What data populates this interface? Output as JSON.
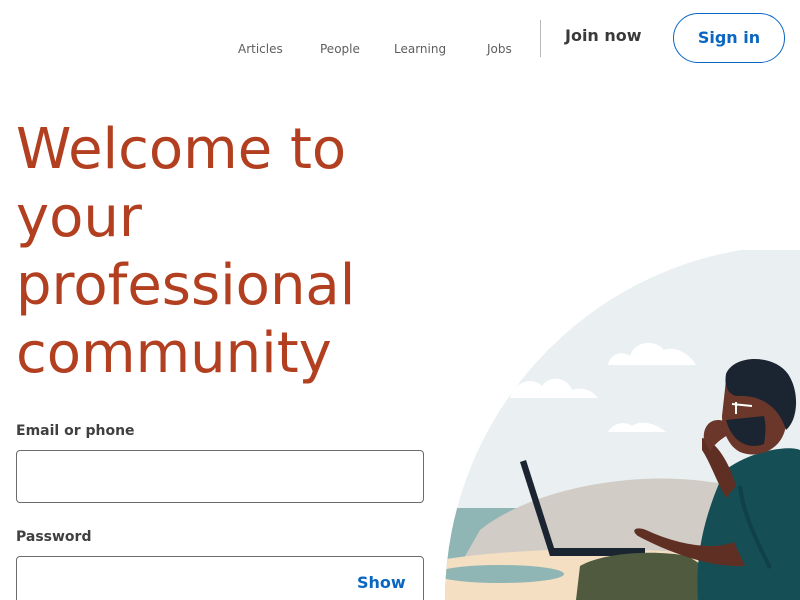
{
  "header": {
    "nav": {
      "articles": "Articles",
      "people": "People",
      "learning": "Learning",
      "jobs": "Jobs"
    },
    "join_now": "Join now",
    "sign_in": "Sign in"
  },
  "hero": {
    "headline_lines": [
      "Welcome to",
      "your",
      "professional",
      "community"
    ],
    "illustration_name": "person-working-on-laptop-at-beach-illustration"
  },
  "form": {
    "email_label": "Email or phone",
    "email_value": "",
    "email_placeholder": "",
    "password_label": "Password",
    "password_value": "",
    "password_placeholder": "",
    "show_label": "Show"
  },
  "colors": {
    "headline": "#b24020",
    "brand_blue": "#0a66c2",
    "nav_text": "#5e5e5e",
    "input_border": "#6b6b6b"
  }
}
